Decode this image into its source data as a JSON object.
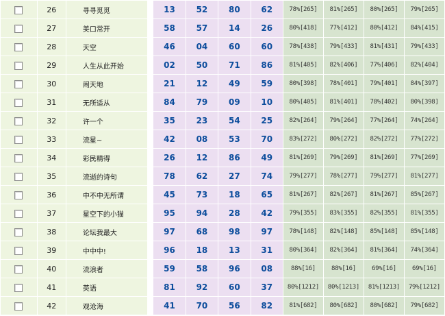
{
  "rows": [
    {
      "id": "26",
      "name": "寻寻觅觅",
      "nums": [
        "13",
        "52",
        "80",
        "62"
      ],
      "pcts": [
        "78%[265]",
        "81%[265]",
        "80%[265]",
        "79%[265]"
      ]
    },
    {
      "id": "27",
      "name": "美口常开",
      "nums": [
        "58",
        "57",
        "14",
        "26"
      ],
      "pcts": [
        "80%[418]",
        "77%[412]",
        "80%[412]",
        "84%[415]"
      ]
    },
    {
      "id": "28",
      "name": "天空",
      "nums": [
        "46",
        "04",
        "60",
        "60"
      ],
      "pcts": [
        "78%[438]",
        "79%[433]",
        "81%[431]",
        "79%[433]"
      ]
    },
    {
      "id": "29",
      "name": "人生从此开始",
      "nums": [
        "02",
        "50",
        "71",
        "86"
      ],
      "pcts": [
        "81%[405]",
        "82%[406]",
        "77%[406]",
        "82%[404]"
      ]
    },
    {
      "id": "30",
      "name": "闹天地",
      "nums": [
        "21",
        "12",
        "49",
        "59"
      ],
      "pcts": [
        "80%[398]",
        "78%[401]",
        "79%[401]",
        "84%[397]"
      ]
    },
    {
      "id": "31",
      "name": "无所适从",
      "nums": [
        "84",
        "79",
        "09",
        "10"
      ],
      "pcts": [
        "80%[405]",
        "81%[401]",
        "78%[402]",
        "80%[398]"
      ]
    },
    {
      "id": "32",
      "name": "许一个",
      "nums": [
        "35",
        "23",
        "54",
        "25"
      ],
      "pcts": [
        "82%[264]",
        "79%[264]",
        "77%[264]",
        "74%[264]"
      ]
    },
    {
      "id": "33",
      "name": "流星~",
      "nums": [
        "42",
        "08",
        "53",
        "70"
      ],
      "pcts": [
        "83%[272]",
        "80%[272]",
        "82%[272]",
        "77%[272]"
      ]
    },
    {
      "id": "34",
      "name": "彩民精得",
      "nums": [
        "26",
        "12",
        "86",
        "49"
      ],
      "pcts": [
        "81%[269]",
        "79%[269]",
        "81%[269]",
        "77%[269]"
      ]
    },
    {
      "id": "35",
      "name": "流逝的诗句",
      "nums": [
        "78",
        "62",
        "27",
        "74"
      ],
      "pcts": [
        "79%[277]",
        "78%[277]",
        "79%[277]",
        "81%[277]"
      ]
    },
    {
      "id": "36",
      "name": "中不中无所谓",
      "nums": [
        "45",
        "73",
        "18",
        "65"
      ],
      "pcts": [
        "81%[267]",
        "82%[267]",
        "81%[267]",
        "85%[267]"
      ]
    },
    {
      "id": "37",
      "name": "星空下的小猫",
      "nums": [
        "95",
        "94",
        "28",
        "42"
      ],
      "pcts": [
        "79%[355]",
        "83%[355]",
        "82%[355]",
        "81%[355]"
      ]
    },
    {
      "id": "38",
      "name": "论坛我最大",
      "nums": [
        "97",
        "68",
        "98",
        "97"
      ],
      "pcts": [
        "78%[148]",
        "82%[148]",
        "85%[148]",
        "85%[148]"
      ]
    },
    {
      "id": "39",
      "name": "中中中!",
      "nums": [
        "96",
        "18",
        "13",
        "31"
      ],
      "pcts": [
        "80%[364]",
        "82%[364]",
        "81%[364]",
        "74%[364]"
      ]
    },
    {
      "id": "40",
      "name": "流浪者",
      "nums": [
        "59",
        "58",
        "96",
        "08"
      ],
      "pcts": [
        "88%[16]",
        "88%[16]",
        "69%[16]",
        "69%[16]"
      ]
    },
    {
      "id": "41",
      "name": "英语",
      "nums": [
        "81",
        "92",
        "60",
        "37"
      ],
      "pcts": [
        "80%[1212]",
        "80%[1213]",
        "81%[1213]",
        "79%[1212]"
      ]
    },
    {
      "id": "42",
      "name": "观沧海",
      "nums": [
        "41",
        "70",
        "56",
        "82"
      ],
      "pcts": [
        "81%[682]",
        "80%[682]",
        "80%[682]",
        "79%[682]"
      ]
    }
  ],
  "colors": {
    "left_bg": "#eef5e0",
    "num_bg": "#ecdff1",
    "num_text": "#0c4d9c",
    "pct_bg": "#d7e4cf"
  }
}
